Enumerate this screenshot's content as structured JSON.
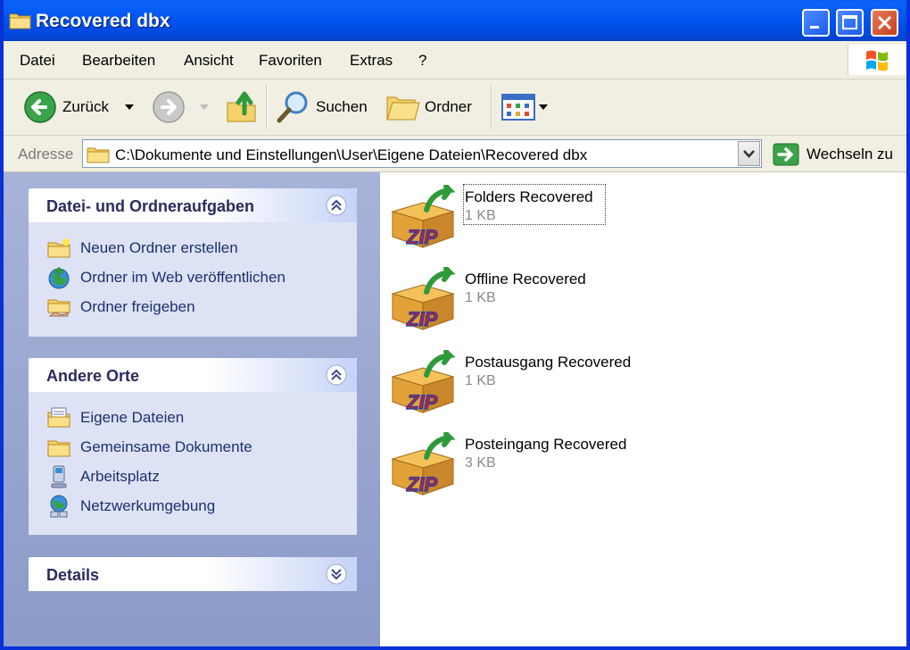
{
  "window": {
    "title": "Recovered dbx"
  },
  "menubar": {
    "items": [
      "Datei",
      "Bearbeiten",
      "Ansicht",
      "Favoriten",
      "Extras",
      "?"
    ]
  },
  "toolbar": {
    "back_label": "Zurück",
    "search_label": "Suchen",
    "folders_label": "Ordner"
  },
  "addressbar": {
    "label": "Adresse",
    "path": "C:\\Dokumente und Einstellungen\\User\\Eigene Dateien\\Recovered dbx",
    "go_label": "Wechseln zu"
  },
  "tasks_panel": {
    "title": "Datei- und Ordneraufgaben",
    "items": [
      {
        "label": "Neuen Ordner erstellen",
        "icon": "new-folder-icon"
      },
      {
        "label": "Ordner im Web veröffentlichen",
        "icon": "web-publish-icon"
      },
      {
        "label": "Ordner freigeben",
        "icon": "share-folder-icon"
      }
    ]
  },
  "places_panel": {
    "title": "Andere Orte",
    "items": [
      {
        "label": "Eigene Dateien",
        "icon": "my-documents-icon"
      },
      {
        "label": "Gemeinsame Dokumente",
        "icon": "shared-documents-icon"
      },
      {
        "label": "Arbeitsplatz",
        "icon": "my-computer-icon"
      },
      {
        "label": "Netzwerkumgebung",
        "icon": "network-icon"
      }
    ]
  },
  "details_panel": {
    "title": "Details"
  },
  "files": [
    {
      "name": "Folders Recovered",
      "size": "1 KB",
      "selected": true
    },
    {
      "name": "Offline Recovered",
      "size": "1 KB",
      "selected": false
    },
    {
      "name": "Postausgang Recovered",
      "size": "1 KB",
      "selected": false
    },
    {
      "name": "Posteingang Recovered",
      "size": "3 KB",
      "selected": false
    }
  ],
  "colors": {
    "titlebar": "#0053ee",
    "panel_title": "#2b2b5e",
    "task_link": "#1f2f6e"
  }
}
